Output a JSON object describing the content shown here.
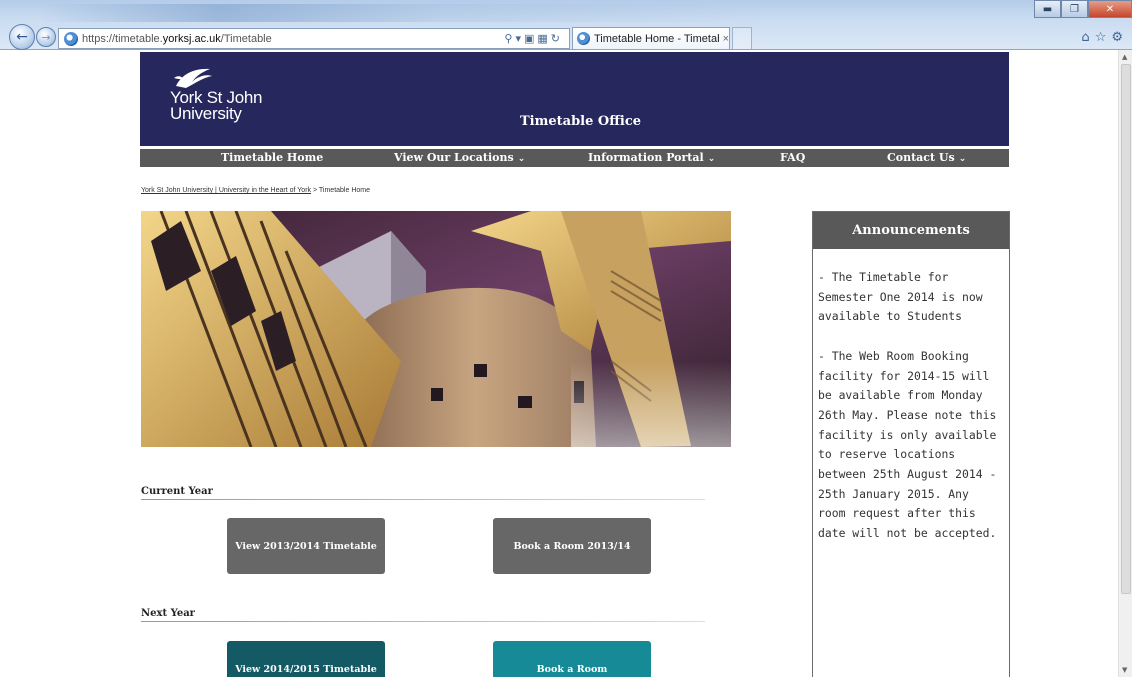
{
  "browser": {
    "url_prefix": "https://timetable.",
    "url_domain": "yorksj.ac.uk",
    "url_path": "/Timetable",
    "tab_title": "Timetable Home - Timetable",
    "tab_close": "×"
  },
  "header": {
    "logo_line1": "York St John",
    "logo_line2": "University",
    "site_title": "Timetable Office"
  },
  "nav": {
    "items": [
      {
        "label": "Timetable Home"
      },
      {
        "label": "View Our Locations"
      },
      {
        "label": "Information Portal"
      },
      {
        "label": "FAQ"
      },
      {
        "label": "Contact Us"
      }
    ]
  },
  "breadcrumb": {
    "link": "York St John University | University in the Heart of York",
    "separator": ">",
    "current": "Timetable Home"
  },
  "sections": {
    "current_year": {
      "title": "Current Year",
      "view_button": "View 2013/2014 Timetable",
      "book_button": "Book a Room 2013/14"
    },
    "next_year": {
      "title": "Next Year",
      "view_button": "View 2014/2015 Timetable",
      "book_button": "Book a Room"
    }
  },
  "announcements": {
    "title": "Announcements",
    "items": [
      "- The Timetable for Semester One 2014 is now available to Students",
      "- The Web Room Booking facility for 2014-15 will be available from Monday 26th May. Please note this facility is only available to reserve locations between 25th August 2014 - 25th January 2015. Any room request after this date will not be accepted."
    ]
  },
  "colors": {
    "banner": "#26275d",
    "nav": "#595959",
    "button_grey": "#676767",
    "button_teal_dark": "#135a65",
    "button_teal": "#168a97"
  }
}
